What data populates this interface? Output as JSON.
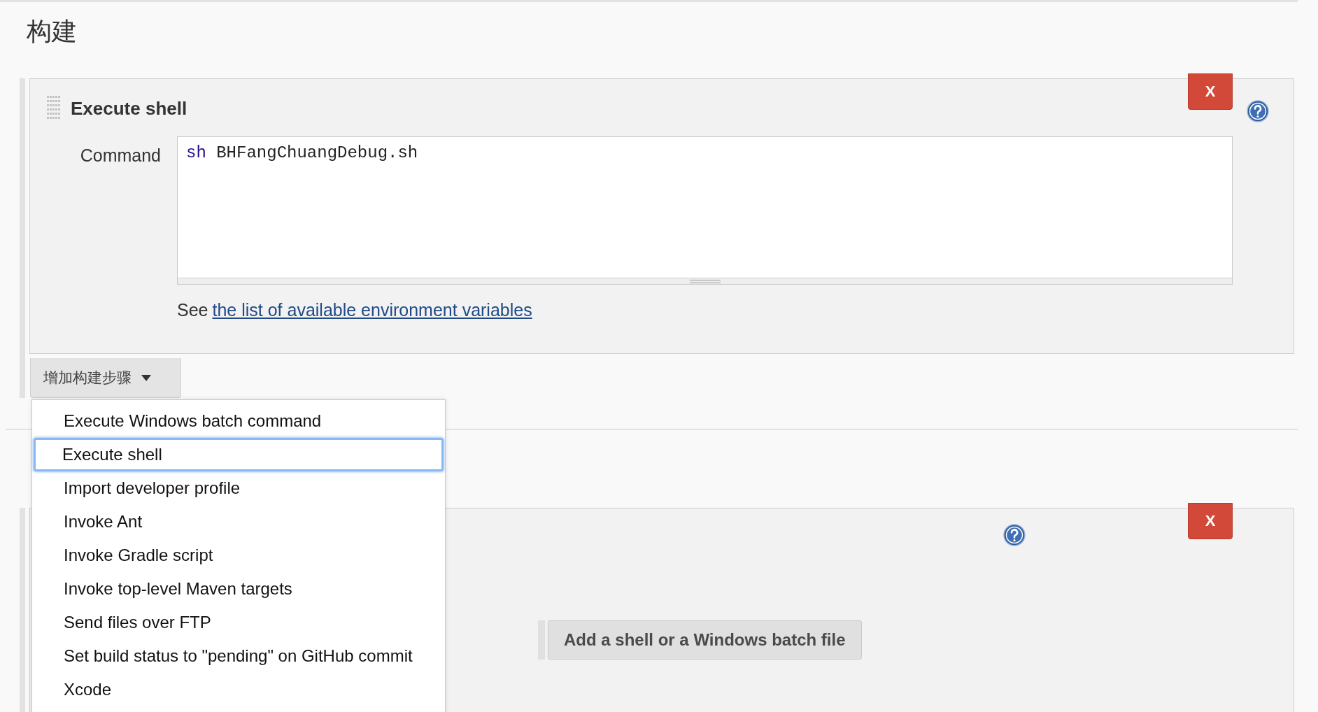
{
  "heading": "构建",
  "first_step": {
    "title": "Execute shell",
    "delete_label": "X",
    "command_label": "Command",
    "command": {
      "keyword": "sh",
      "args": "BHFangChuangDebug.sh"
    },
    "note_prefix": "See",
    "note_link": "the list of available environment variables"
  },
  "add_step_button": "增加构建步骤",
  "menu": {
    "items": [
      {
        "label": "Execute Windows batch command",
        "selected": false
      },
      {
        "label": "Execute shell",
        "selected": true
      },
      {
        "label": "Import developer profile",
        "selected": false
      },
      {
        "label": "Invoke Ant",
        "selected": false
      },
      {
        "label": "Invoke Gradle script",
        "selected": false
      },
      {
        "label": "Invoke top-level Maven targets",
        "selected": false
      },
      {
        "label": "Send files over FTP",
        "selected": false
      },
      {
        "label": "Set build status to \"pending\" on GitHub commit",
        "selected": false
      },
      {
        "label": "Xcode",
        "selected": false
      }
    ]
  },
  "second_step": {
    "delete_label": "X",
    "add_button": "Add a shell or a Windows batch file"
  }
}
